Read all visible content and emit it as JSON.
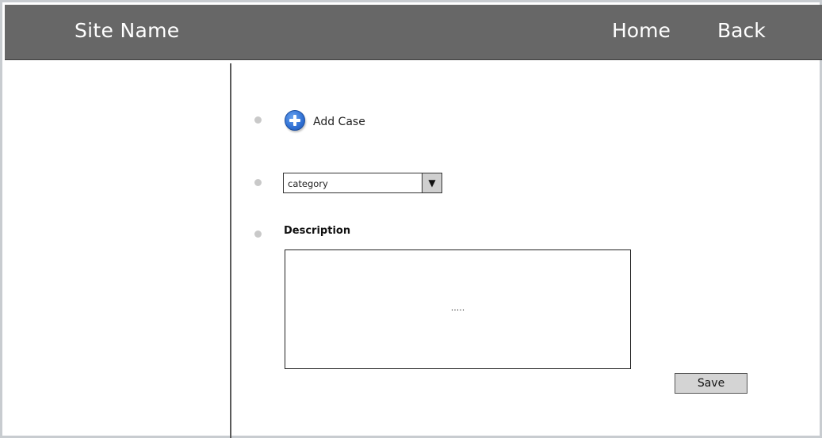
{
  "header": {
    "site_name": "Site Name",
    "nav": {
      "home": "Home",
      "back": "Back"
    }
  },
  "form": {
    "add_case_label": "Add Case",
    "category": {
      "selected": "category"
    },
    "description": {
      "label": "Description",
      "value": "....."
    },
    "save_label": "Save"
  },
  "colors": {
    "header_bg": "#676767",
    "icon_blue": "#2f6fd3",
    "button_bg": "#d4d4d4"
  },
  "icons": {
    "add": "plus-circle-icon",
    "dropdown": "triangle-down-icon"
  }
}
